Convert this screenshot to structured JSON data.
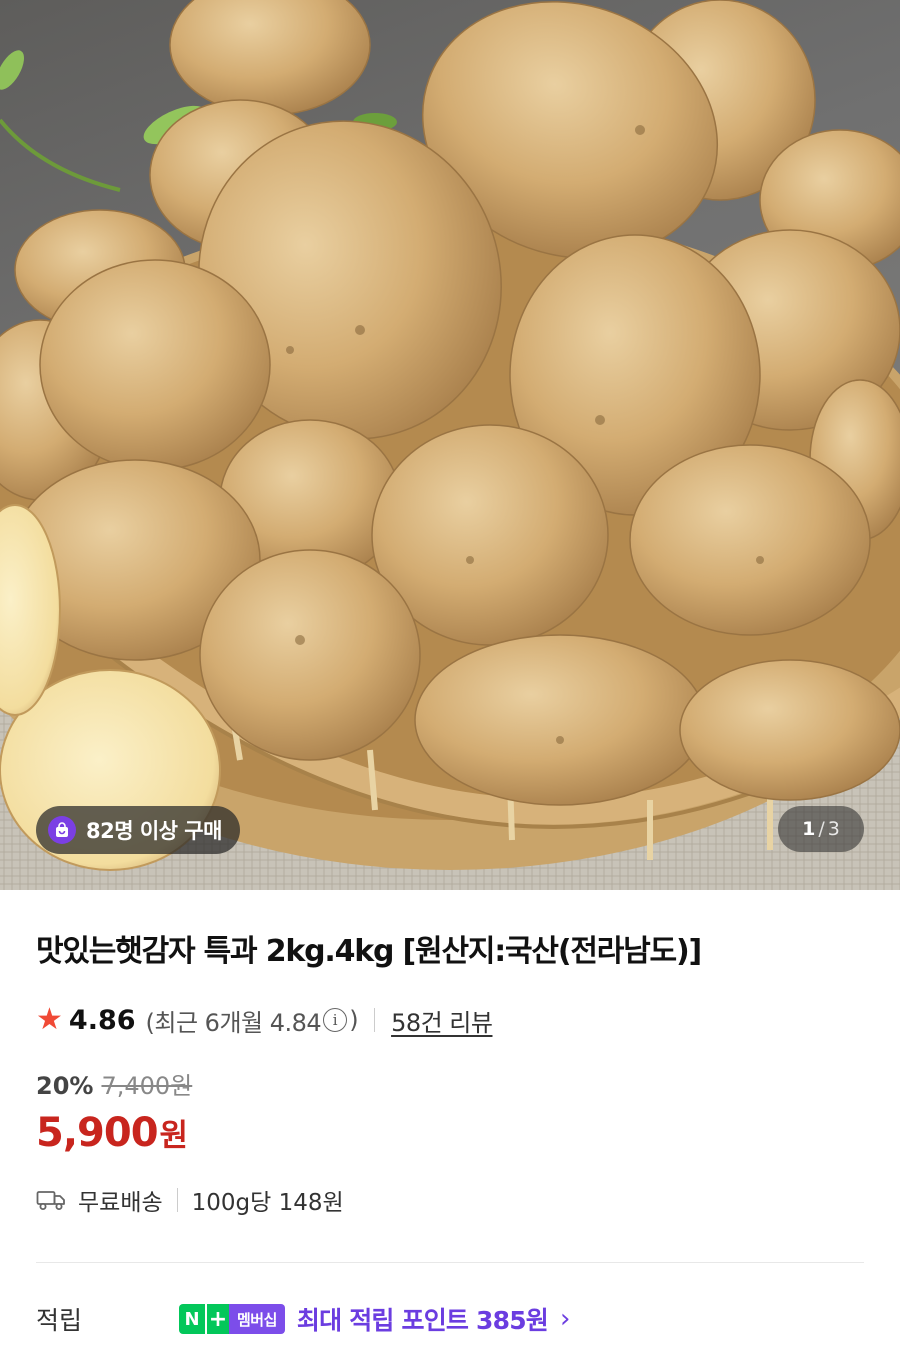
{
  "hero": {
    "badge_text": "82명 이상 구매",
    "page_current": "1",
    "page_separator": "/",
    "page_total": "3"
  },
  "product": {
    "title": "맛있는햇감자 특과 2kg.4kg [원산지:국산(전라남도)]",
    "rating": "4.86",
    "recent_rating_text": "(최근 6개월 4.84",
    "recent_rating_close": ")",
    "review_count": "58건 리뷰",
    "discount_rate": "20%",
    "original_price": "7,400원",
    "price": "5,900",
    "price_unit": "원",
    "shipping": "무료배송",
    "unit_price": "100g당 148원"
  },
  "points": {
    "label": "적립",
    "badge_n": "N",
    "badge_plus": "+",
    "badge_membership": "멤버십",
    "text": "최대 적립 포인트 385원"
  },
  "colors": {
    "price_red": "#c8251e",
    "star_red": "#f04a36",
    "naver_green": "#03c75a",
    "membership_purple": "#7c4dea"
  },
  "icons": [
    "star-icon",
    "info-icon",
    "truck-icon",
    "shopping-bag-icon",
    "chevron-right-icon"
  ]
}
